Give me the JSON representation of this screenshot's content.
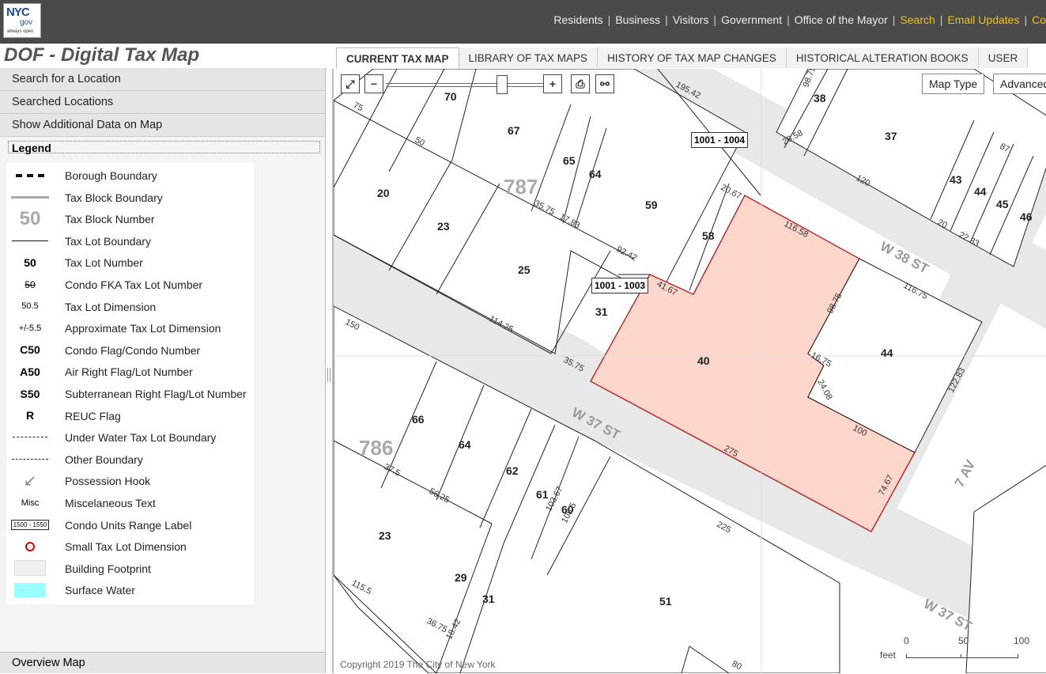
{
  "header": {
    "logo": {
      "brand": "NYC",
      "gov": "gov",
      "tagline": "always open"
    },
    "nav": [
      {
        "label": "Residents",
        "highlight": false
      },
      {
        "label": "Business",
        "highlight": false
      },
      {
        "label": "Visitors",
        "highlight": false
      },
      {
        "label": "Government",
        "highlight": false
      },
      {
        "label": "Office of the Mayor",
        "highlight": false
      },
      {
        "label": "Search",
        "highlight": true
      },
      {
        "label": "Email Updates",
        "highlight": true
      },
      {
        "label": "Co",
        "highlight": true
      }
    ],
    "separator": "|"
  },
  "app_title": "DOF - Digital Tax Map",
  "tabs": [
    {
      "label": "CURRENT TAX MAP",
      "active": true
    },
    {
      "label": "LIBRARY OF TAX MAPS",
      "active": false
    },
    {
      "label": "HISTORY OF TAX MAP CHANGES",
      "active": false
    },
    {
      "label": "HISTORICAL ALTERATION BOOKS",
      "active": false
    },
    {
      "label": "USER",
      "active": false
    }
  ],
  "left_panel": {
    "sections": [
      "Search for a Location",
      "Searched Locations",
      "Show Additional Data on Map"
    ],
    "legend_title": "Legend",
    "legend": [
      {
        "symbol": "dash-thick",
        "label": "Borough Boundary"
      },
      {
        "symbol": "gray-line",
        "label": "Tax Block Boundary"
      },
      {
        "symbol": "text",
        "text": "50",
        "label": "Tax Block Number"
      },
      {
        "symbol": "thin-line",
        "label": "Tax Lot Boundary"
      },
      {
        "symbol": "text",
        "text": "50",
        "label": "Tax Lot Number"
      },
      {
        "symbol": "text",
        "text": "50",
        "label": "Condo FKA Tax Lot Number"
      },
      {
        "symbol": "text",
        "text": "50.5",
        "label": "Tax Lot Dimension"
      },
      {
        "symbol": "text",
        "text": "+/-5.5",
        "label": "Approximate Tax Lot Dimension"
      },
      {
        "symbol": "text",
        "text": "C50",
        "label": "Condo Flag/Condo Number"
      },
      {
        "symbol": "text",
        "text": "A50",
        "label": "Air Right Flag/Lot Number"
      },
      {
        "symbol": "text",
        "text": "S50",
        "label": "Subterranean Right Flag/Lot Number"
      },
      {
        "symbol": "text",
        "text": "R",
        "label": "REUC Flag"
      },
      {
        "symbol": "dashed-line",
        "label": "Under Water Tax Lot Boundary"
      },
      {
        "symbol": "dash-dot-line",
        "label": "Other Boundary"
      },
      {
        "symbol": "hook",
        "label": "Possession Hook"
      },
      {
        "symbol": "text",
        "text": "Misc",
        "label": "Miscelaneous Text"
      },
      {
        "symbol": "box-text",
        "text": "1500 - 1550",
        "label": "Condo Units Range Label"
      },
      {
        "symbol": "red-circle",
        "label": "Small Tax Lot Dimension"
      },
      {
        "symbol": "footprint",
        "label": "Building Footprint"
      },
      {
        "symbol": "water",
        "label": "Surface Water"
      }
    ],
    "overview_map": "Overview Map"
  },
  "map": {
    "controls": {
      "map_type": "Map Type",
      "advanced": "Advanced"
    },
    "condo_labels": [
      "1001 - 1004",
      "1001 - 1003"
    ],
    "streets": [
      "W 38 ST",
      "W 37 ST",
      "7 AV",
      "W 37 ST"
    ],
    "blocks": [
      "787",
      "786"
    ],
    "lots_top": [
      "70",
      "67",
      "65",
      "64",
      "20",
      "23",
      "25",
      "59",
      "58",
      "31",
      "38",
      "37",
      "43",
      "44",
      "45",
      "46"
    ],
    "lots_mid": [
      "40",
      "44"
    ],
    "lots_bottom": [
      "66",
      "64",
      "62",
      "61",
      "60",
      "23",
      "29",
      "31",
      "51"
    ],
    "dimensions": [
      "195.42",
      "98.75",
      "35.75",
      "17.83",
      "92.42",
      "20.67",
      "116.58",
      "41.67",
      "114.25",
      "35.75",
      "275",
      "74.67",
      "100",
      "24.08",
      "16.75",
      "98.75",
      "122.83",
      "116.75",
      "120",
      "20.58",
      "22.33",
      "225",
      "115.5",
      "37.5",
      "56.25",
      "36.75",
      "18.42",
      "108.5",
      "103.67",
      "150",
      "75",
      "50",
      "80",
      "20",
      "87"
    ],
    "copyright": "Copyright 2019 The City of New York",
    "scale": {
      "unit": "feet",
      "ticks": [
        "0",
        "50",
        "100"
      ]
    },
    "highlight_color": "#fcd6cb",
    "highlight_border": "#b03030"
  }
}
